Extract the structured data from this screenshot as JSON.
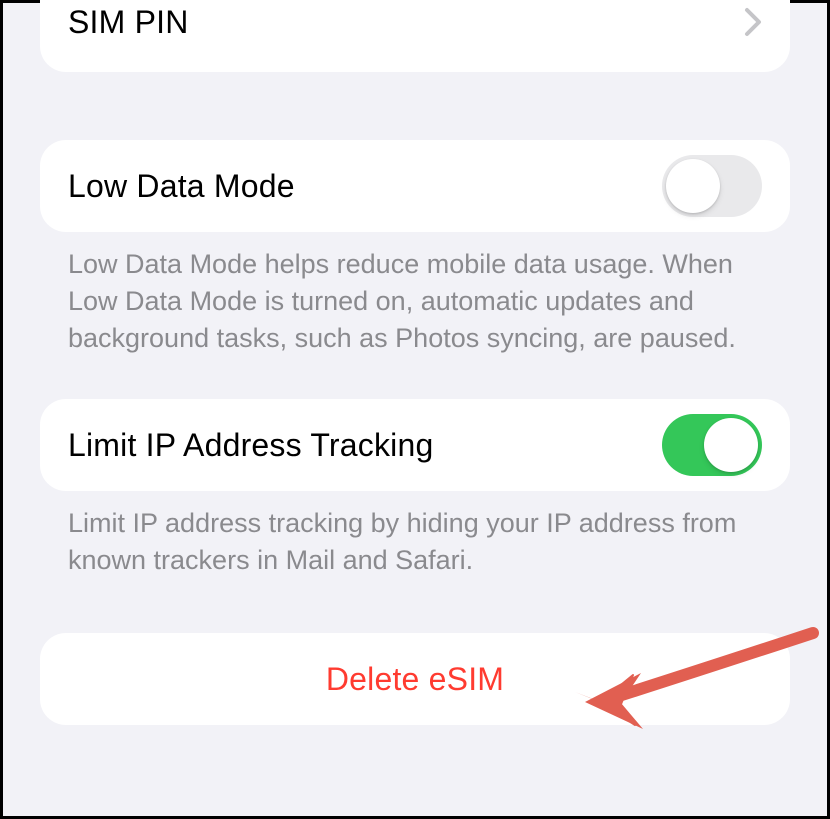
{
  "sim_pin": {
    "label": "SIM PIN"
  },
  "low_data_mode": {
    "label": "Low Data Mode",
    "enabled": false,
    "footer": "Low Data Mode helps reduce mobile data usage. When Low Data Mode is turned on, automatic updates and background tasks, such as Photos syncing, are paused."
  },
  "limit_ip_tracking": {
    "label": "Limit IP Address Tracking",
    "enabled": true,
    "footer": "Limit IP address tracking by hiding your IP address from known trackers in Mail and Safari."
  },
  "delete_esim": {
    "label": "Delete eSIM"
  },
  "annotation": {
    "arrow_color": "#e15f51"
  }
}
